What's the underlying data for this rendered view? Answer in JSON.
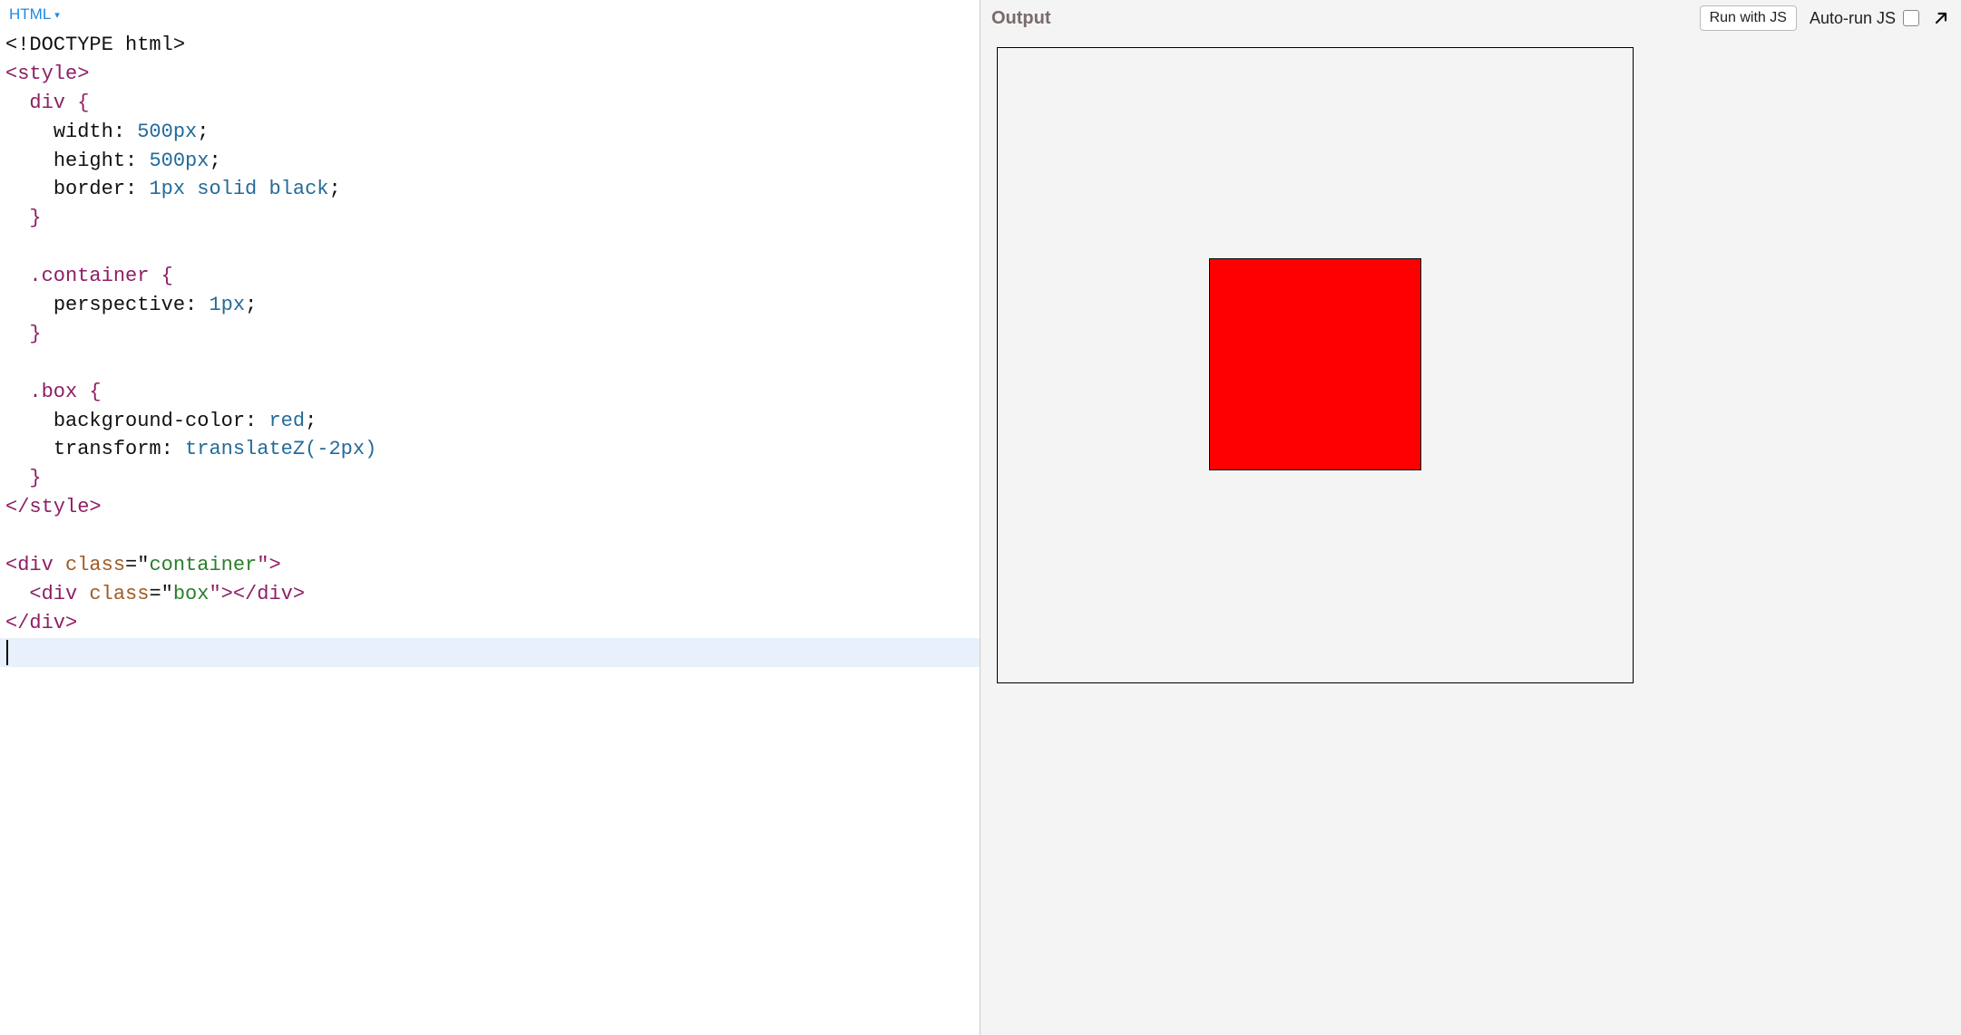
{
  "editor": {
    "languageLabel": "HTML",
    "caretGlyph": "▾",
    "code": {
      "l1": "<!DOCTYPE html>",
      "l2": {
        "open": "<",
        "tag": "style",
        "close": ">"
      },
      "l3": "  div {",
      "l4": {
        "indent": "    ",
        "prop": "width",
        "colon": ": ",
        "val": "500px",
        "semi": ";"
      },
      "l5": {
        "indent": "    ",
        "prop": "height",
        "colon": ": ",
        "val": "500px",
        "semi": ";"
      },
      "l6": {
        "indent": "    ",
        "prop": "border",
        "colon": ": ",
        "val": "1px solid black",
        "semi": ";"
      },
      "l7": "  }",
      "l8": "",
      "l9": "  .container {",
      "l10": {
        "indent": "    ",
        "prop": "perspective",
        "colon": ": ",
        "val": "1px",
        "semi": ";"
      },
      "l11": "  }",
      "l12": "",
      "l13": "  .box {",
      "l14": {
        "indent": "    ",
        "prop": "background-color",
        "colon": ": ",
        "val": "red",
        "semi": ";"
      },
      "l15": {
        "indent": "    ",
        "prop": "transform",
        "colon": ": ",
        "val": "translateZ(-2px)"
      },
      "l16": "  }",
      "l17": {
        "open": "</",
        "tag": "style",
        "close": ">"
      },
      "l18": "",
      "l19": {
        "open": "<",
        "tag": "div",
        "sp": " ",
        "attr": "class",
        "eq": "=\"",
        "strv": "container",
        "endq": "\">"
      },
      "l20": {
        "indent": "  ",
        "open": "<",
        "tag": "div",
        "sp": " ",
        "attr": "class",
        "eq": "=\"",
        "strv": "box",
        "endq": "\">",
        "open2": "</",
        "tag2": "div",
        "close2": ">"
      },
      "l21": {
        "open": "</",
        "tag": "div",
        "close": ">"
      }
    }
  },
  "output": {
    "title": "Output",
    "runLabel": "Run with JS",
    "autorunLabel": "Auto-run JS"
  },
  "preview": {
    "containerSizePx": 500,
    "boxColor": "red",
    "perspectivePx": 1,
    "translateZPx": -2
  }
}
